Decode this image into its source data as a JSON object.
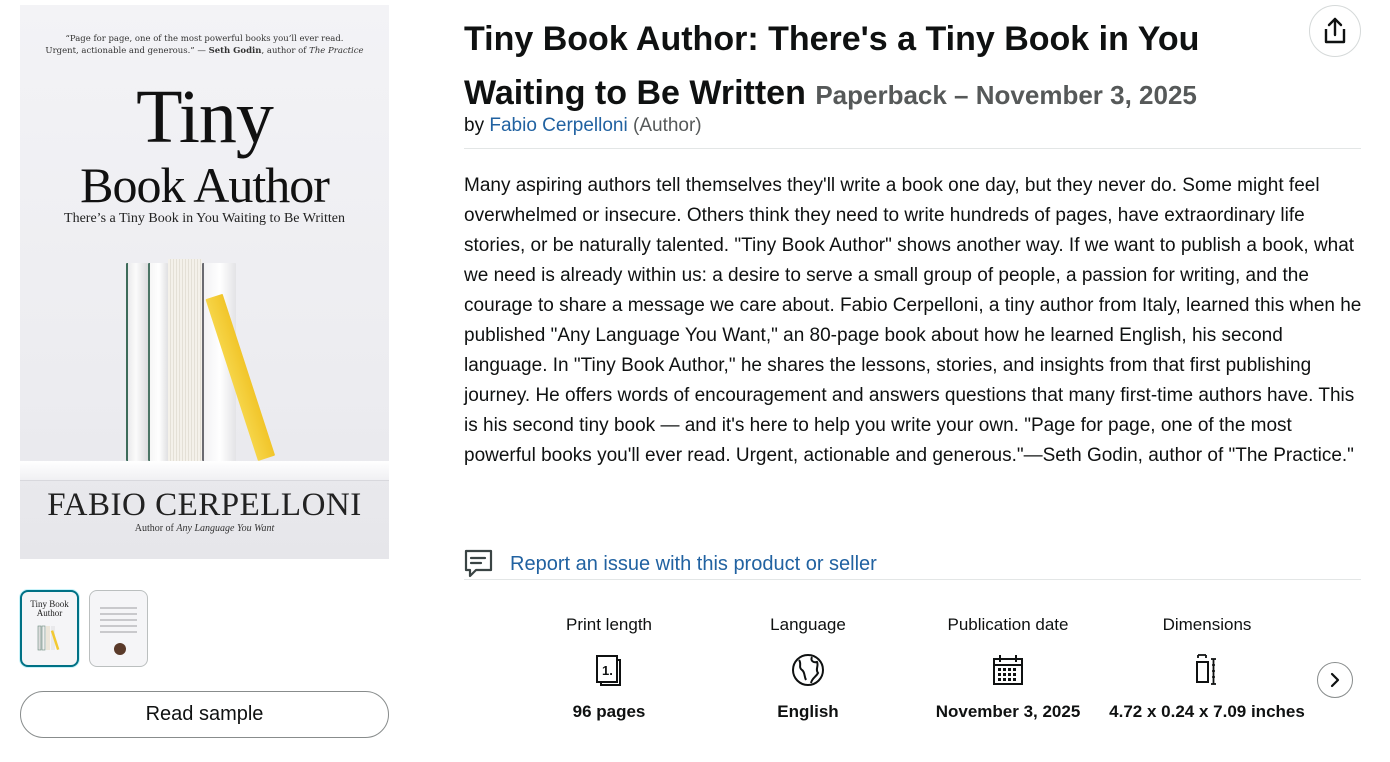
{
  "cover": {
    "blurb_line1": "“Page for page, one of the most powerful books you’ll ever read.",
    "blurb_line2_prefix": "Urgent, actionable and generous.” — ",
    "blurb_author": "Seth Godin",
    "blurb_suffix": ", author of ",
    "blurb_work": "The Practice",
    "title_line1": "Tiny",
    "title_line2": "Book Author",
    "subtitle": "There’s a Tiny Book in You Waiting to Be Written",
    "author_name": "FABIO CERPELLONI",
    "author_of_prefix": "Author of ",
    "author_of_work": "Any Language You Want",
    "accent_color": "#f3d33a"
  },
  "thumbnails": [
    {
      "label": "Tiny Book Author",
      "selected": true
    },
    {
      "label": "",
      "selected": false
    }
  ],
  "read_sample_label": "Read sample",
  "product": {
    "title": "Tiny Book Author: There's a Tiny Book in You Waiting to Be Written",
    "format": "Paperback – November 3, 2025",
    "by_label": "by",
    "author": "Fabio Cerpelloni",
    "author_role": "(Author)",
    "description": "Many aspiring authors tell themselves they'll write a book one day, but they never do. Some might feel overwhelmed or insecure. Others think they need to write hundreds of pages, have extraordinary life stories, or be naturally talented. \"Tiny Book Author\" shows another way. If we want to publish a book, what we need is already within us: a desire to serve a small group of people, a passion for writing, and the courage to share a message we care about. Fabio Cerpelloni, a tiny author from Italy, learned this when he published \"Any Language You Want,\" an 80-page book about how he learned English, his second language. In \"Tiny Book Author,\" he shares the lessons, stories, and insights from that first publishing journey. He offers words of encouragement and answers questions that many first-time authors have. This is his second tiny book — and it's here to help you write your own. \"Page for page, one of the most powerful books you'll ever read. Urgent, actionable and generous.\"—Seth Godin, author of \"The Practice.\"",
    "report_link": "Report an issue with this product or seller"
  },
  "details": [
    {
      "label": "Print length",
      "icon": "book-pages-icon",
      "value": "96 pages"
    },
    {
      "label": "Language",
      "icon": "globe-icon",
      "value": "English"
    },
    {
      "label": "Publication date",
      "icon": "calendar-icon",
      "value": "November 3, 2025"
    },
    {
      "label": "Dimensions",
      "icon": "dimensions-icon",
      "value": "4.72 x 0.24 x 7.09 inches"
    }
  ],
  "colors": {
    "link": "#2162a1",
    "text": "#0f1111",
    "muted": "#565959",
    "thumb_selected_border": "#007185"
  }
}
